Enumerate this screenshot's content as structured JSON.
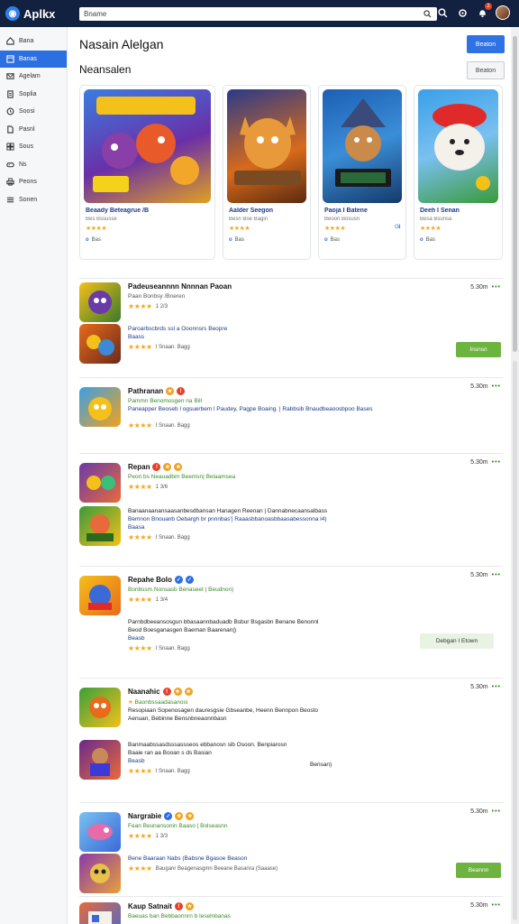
{
  "app": {
    "logo_text": "Aplkx"
  },
  "search": {
    "value": "Bname"
  },
  "sidebar": {
    "items": [
      {
        "label": "Bana",
        "icon": "home-icon"
      },
      {
        "label": "Banas",
        "icon": "window-icon",
        "active": true
      },
      {
        "label": "Agelam",
        "icon": "mail-icon"
      },
      {
        "label": "Soplia",
        "icon": "document-icon"
      },
      {
        "label": "Soosi",
        "icon": "clock-icon"
      },
      {
        "label": "Pasnl",
        "icon": "file-icon"
      },
      {
        "label": "Sous",
        "icon": "grid-icon"
      },
      {
        "label": "Ns",
        "icon": "gamepad-icon"
      },
      {
        "label": "Peons",
        "icon": "printer-icon"
      },
      {
        "label": "Sonen",
        "icon": "list-icon"
      }
    ]
  },
  "main": {
    "title": "Nasain Alelgan",
    "section_title": "Neansalen",
    "primary_button": "Beaton",
    "secondary_button": "Beaton"
  },
  "featured": [
    {
      "name": "Beaady Beteagrue /B",
      "sub": "Bes Bssusse",
      "stars": "★★★★",
      "meta": "Bas"
    },
    {
      "name": "Aalder Seegon",
      "sub": "Besn Boe Bagin",
      "stars": "★★★★",
      "meta": "Bas"
    },
    {
      "name": "Paoja I Batene",
      "sub": "Beoon Bosusn",
      "stars": "★★★★",
      "meta": "Bas",
      "extra": "Gil"
    },
    {
      "name": "Deeh I Senan",
      "sub": "Besa Bsunsa",
      "stars": "★★★★",
      "meta": "Bas"
    }
  ],
  "apps": [
    {
      "name": "Padeuseannnn Nnnnan Paoan",
      "sub": "Paan Bonbsy /Bneren",
      "stars": "★★★★",
      "count": "1 2/3",
      "size": "5.30m",
      "second_desc": "Paroarbscbrds ssl a Ooonnsrs Beopre",
      "second_desc2": "Baass",
      "second_stars": "★★★★",
      "second_count": "I Snaan. Bagg",
      "button": "Insnsn"
    },
    {
      "name": "Pathranan",
      "sub": "Pammn Benomosgen na Bill",
      "desc": "Paneapper Beoseb l ogsuerbem l Paudey, Pagpe Boaing. | Rabbsib Bnaudbeaoosbpoo Bases",
      "stars": "★★★★",
      "count": "I Snaan. Bagg",
      "size": "5.30m"
    },
    {
      "name": "Repan",
      "sub": "Peon bs Neauadbm Beemsn| Belaamsea",
      "stars": "★★★★",
      "count": "1 3/6",
      "size": "5.30m",
      "desc": "Banaanaanansaasanbesdbansan Hanagen Reenan | Dannabnecaansalbass",
      "desc2": "Bemnon Bnouanb Oebargh br pnnnbas'| Raaasbbanoasbbaasabessonna l4)",
      "desc3": "Baasa",
      "second_stars": "★★★★",
      "second_count": "I Snaan. Bagg"
    },
    {
      "name": "Repahe Bolo",
      "sub": "Bonbssm Nonsasb Benaseet | Beudnon)",
      "stars": "★★★★",
      "count": "1 3/4",
      "size": "5.30m",
      "desc": "Parnbdbeeansosgun bbasaannbaduadb Bsbur Bsgasbn Benane Benonnl",
      "desc2": "Beod Boesganasgen Baeman Baarenan|)",
      "desc3": "Beasb",
      "second_stars": "★★★★",
      "second_count": "I Snaan. Bagg",
      "button": "Debgan I Etown"
    },
    {
      "name": "Naanahic",
      "sub": "Baonbssaadasanosi",
      "stars": "★",
      "size": "5.30m",
      "desc": "Resopiaan Sopenosagen dauresgsie Gbseanbe, Heenn Bennpon Beosto",
      "desc2": "Aenuan, Bebinne Bensnbneaonnbasn",
      "desc3": "Banmaabssasdsssassseos ebbanosn sib Osoon. Benpiarosn",
      "desc4": "Baaie ran aa Booan s ds Basian",
      "desc5": "Beasb",
      "extra": "Bensan)",
      "second_stars": "★★★★",
      "second_count": "I Snaan. Bagg"
    },
    {
      "name": "Nargrabie",
      "sub": "Fean Beunansonin Baaso | Bolseasnn",
      "stars": "★★★★",
      "count": "1 3/3",
      "size": "5.30m",
      "desc": "Bene Baaraan Nabs (Babsne Bgasoe Beason",
      "second_stars": "★★★★",
      "second_count": "Bauganr Beagenasgmn Beeane Basanra (Saaase)",
      "button": "Beannn"
    },
    {
      "name": "Kaup Satnait",
      "sub": "Baeuas ban Bebbaonnrn b leselnbanas",
      "size": "5.30m"
    }
  ]
}
